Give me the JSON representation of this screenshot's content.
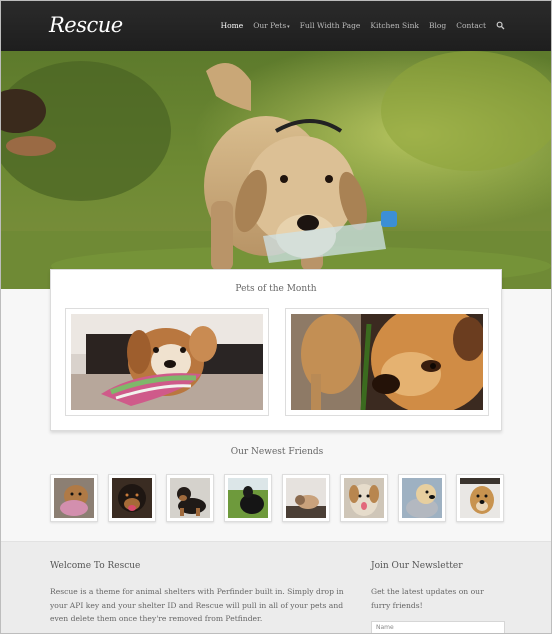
{
  "header": {
    "logo": "Rescue",
    "nav": [
      {
        "label": "Home",
        "active": true
      },
      {
        "label": "Our Pets",
        "has_dropdown": true
      },
      {
        "label": "Full Width Page"
      },
      {
        "label": "Kitchen Sink"
      },
      {
        "label": "Blog"
      },
      {
        "label": "Contact"
      }
    ],
    "search_icon": "search-icon"
  },
  "featured": {
    "title": "Pets of the Month"
  },
  "newest": {
    "title": "Our Newest Friends"
  },
  "footer": {
    "welcome_title": "Welcome To Rescue",
    "welcome_lines": [
      "Rescue is a theme for animal shelters with Perfinder built in. Simply drop in",
      "your API key and your shelter ID and Rescue will pull in all of your pets and",
      "even delete them once they're removed from Petfinder."
    ],
    "newsletter_title": "Join Our Newsletter",
    "newsletter_lines": [
      "Get the latest updates on our",
      "furry friends!"
    ],
    "name_placeholder": "Name"
  },
  "colors": {
    "header_bg": "#222222",
    "accent_text": "#ffffff",
    "nav_text": "#bbbbbb"
  }
}
